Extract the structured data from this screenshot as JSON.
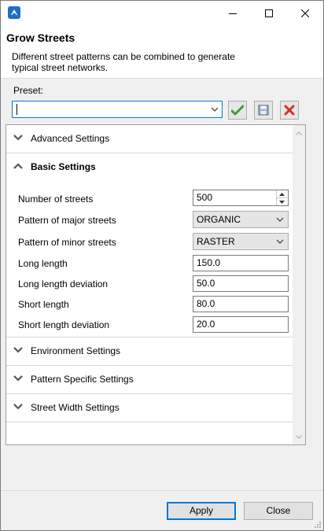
{
  "window": {
    "title_bar_text": "",
    "minimize_label": "minimize",
    "maximize_label": "maximize",
    "close_label": "close"
  },
  "dialog": {
    "title": "Grow Streets",
    "description": "Different street patterns can be combined to generate typical street networks."
  },
  "preset": {
    "label": "Preset:",
    "value": "",
    "apply_icon": "checkmark-icon",
    "save_icon": "floppy-disk-icon",
    "delete_icon": "red-x-icon"
  },
  "sections": {
    "advanced": {
      "label": "Advanced Settings",
      "expanded": false
    },
    "basic": {
      "label": "Basic Settings",
      "expanded": true
    },
    "environment": {
      "label": "Environment Settings",
      "expanded": false
    },
    "pattern_specific": {
      "label": "Pattern Specific Settings",
      "expanded": false
    },
    "street_width": {
      "label": "Street Width Settings",
      "expanded": false
    }
  },
  "basic_settings": {
    "number_of_streets": {
      "label": "Number of streets",
      "value": "500"
    },
    "pattern_major": {
      "label": "Pattern of major streets",
      "value": "ORGANIC"
    },
    "pattern_minor": {
      "label": "Pattern of minor streets",
      "value": "RASTER"
    },
    "long_length": {
      "label": "Long length",
      "value": "150.0"
    },
    "long_length_deviation": {
      "label": "Long length deviation",
      "value": "50.0"
    },
    "short_length": {
      "label": "Short length",
      "value": "80.0"
    },
    "short_length_deviation": {
      "label": "Short length deviation",
      "value": "20.0"
    }
  },
  "footer": {
    "apply_label": "Apply",
    "close_label": "Close"
  },
  "colors": {
    "accent": "#0078d7",
    "apply_check": "#3aa02c",
    "delete_x": "#d32f2f"
  }
}
